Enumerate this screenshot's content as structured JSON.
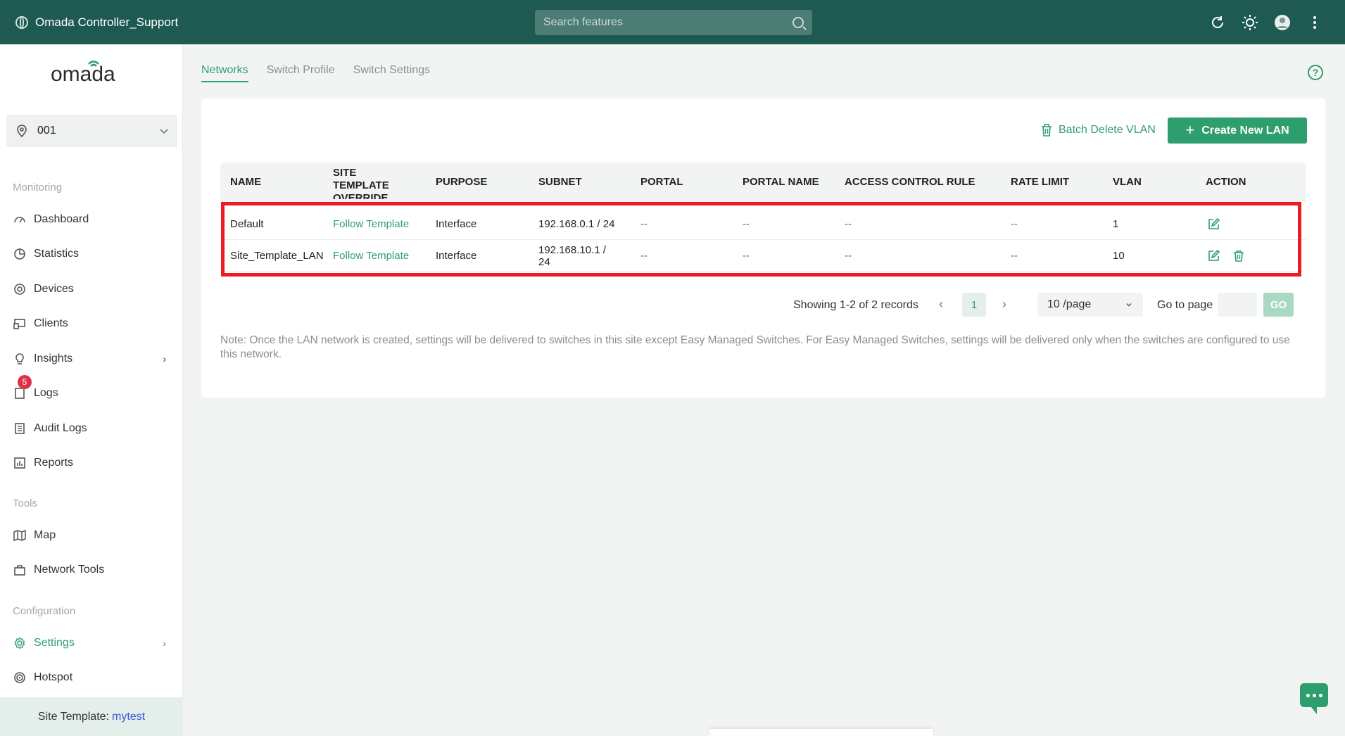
{
  "topbar": {
    "title": "Omada Controller_Support",
    "search_placeholder": "Search features"
  },
  "sidebar": {
    "logo_text": "omada",
    "site": "001",
    "sections": {
      "monitoring": "Monitoring",
      "tools": "Tools",
      "configuration": "Configuration"
    },
    "items": {
      "dashboard": "Dashboard",
      "statistics": "Statistics",
      "devices": "Devices",
      "clients": "Clients",
      "insights": "Insights",
      "logs": "Logs",
      "logs_badge": "5",
      "audit_logs": "Audit Logs",
      "reports": "Reports",
      "map": "Map",
      "network_tools": "Network Tools",
      "settings": "Settings",
      "hotspot": "Hotspot"
    },
    "site_template_label": "Site Template:",
    "site_template_value": "mytest"
  },
  "tabs": [
    "Networks",
    "Switch Profile",
    "Switch Settings"
  ],
  "toolbar": {
    "batch_delete": "Batch Delete VLAN",
    "create_new": "Create New LAN"
  },
  "table": {
    "headers": {
      "name": "NAME",
      "site_template_override": "SITE TEMPLATE OVERRIDE",
      "purpose": "PURPOSE",
      "subnet": "SUBNET",
      "portal": "PORTAL",
      "portal_name": "PORTAL NAME",
      "access_control_rule": "ACCESS CONTROL RULE",
      "rate_limit": "RATE LIMIT",
      "vlan": "VLAN",
      "action": "ACTION"
    },
    "rows": [
      {
        "name": "Default",
        "override": "Follow Template",
        "purpose": "Interface",
        "subnet": "192.168.0.1 / 24",
        "portal": "--",
        "portal_name": "--",
        "acl": "--",
        "rate_limit": "--",
        "vlan": "1"
      },
      {
        "name": "Site_Template_LAN",
        "override": "Follow Template",
        "purpose": "Interface",
        "subnet": "192.168.10.1 / 24",
        "portal": "--",
        "portal_name": "--",
        "acl": "--",
        "rate_limit": "--",
        "vlan": "10"
      }
    ]
  },
  "pagination": {
    "summary": "Showing 1-2 of 2 records",
    "current_page": "1",
    "page_size": "10 /page",
    "go_to_label": "Go to page",
    "go_button": "GO"
  },
  "note": "Note: Once the LAN network is created, settings will be delivered to switches in this site except Easy Managed Switches. For Easy Managed Switches, settings will be delivered only when the switches are configured to use this network.",
  "colors": {
    "topbar": "#1e5a52",
    "accent": "#2f9e6e",
    "highlight_box": "#ec1c24"
  }
}
